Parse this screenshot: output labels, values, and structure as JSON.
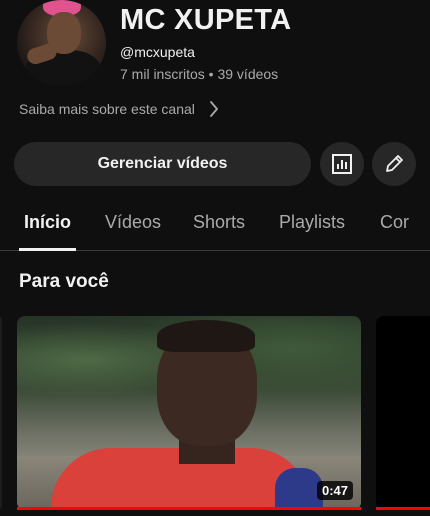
{
  "channel": {
    "title": "MC XUPETA",
    "handle": "@mcxupeta",
    "stats": "7 mil inscritos • 39 vídeos",
    "about_link": "Saiba mais sobre este canal"
  },
  "actions": {
    "manage_label": "Gerenciar vídeos"
  },
  "tabs": [
    {
      "label": "Início",
      "active": true
    },
    {
      "label": "Vídeos",
      "active": false
    },
    {
      "label": "Shorts",
      "active": false
    },
    {
      "label": "Playlists",
      "active": false
    },
    {
      "label": "Cor",
      "active": false
    }
  ],
  "section": {
    "title": "Para você"
  },
  "video": {
    "duration": "0:47",
    "watched_fraction": 1.0
  },
  "icons": [
    "chevron-right-icon",
    "analytics-icon",
    "edit-pencil-icon"
  ],
  "colors": {
    "background": "#0f0f0f",
    "button": "#272727",
    "progress": "#ff0000",
    "secondary_text": "#aaaaaa"
  }
}
